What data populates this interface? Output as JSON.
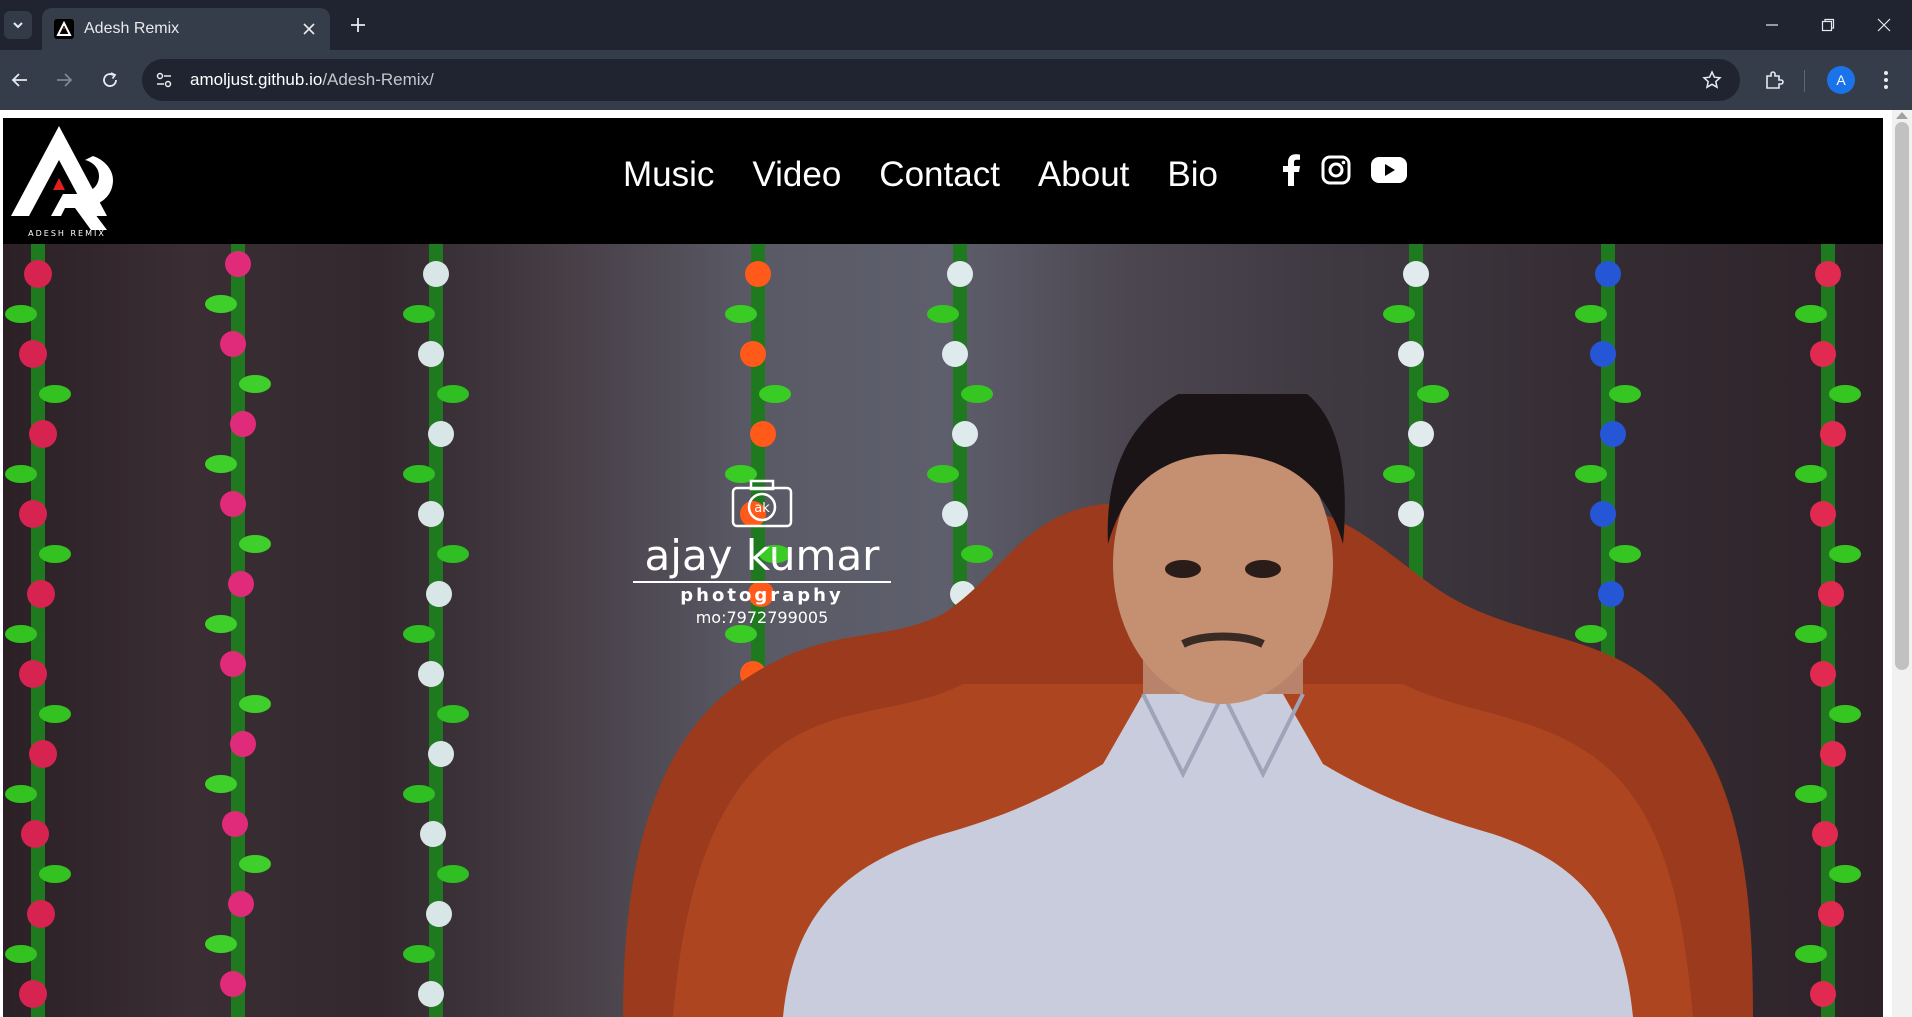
{
  "browser": {
    "tab": {
      "title": "Adesh Remix"
    },
    "url": {
      "host": "amoljust.github.io",
      "path": "/Adesh-Remix/"
    },
    "profile_initial": "A"
  },
  "site": {
    "logo_text": "ADESH REMIX",
    "nav": [
      {
        "label": "Music"
      },
      {
        "label": "Video"
      },
      {
        "label": "Contact"
      },
      {
        "label": "About"
      },
      {
        "label": "Bio"
      }
    ],
    "socials": [
      "facebook-icon",
      "instagram-icon",
      "youtube-icon"
    ]
  },
  "hero": {
    "watermark": {
      "badge": "ak",
      "name": "ajay kumar",
      "subtitle": "photography",
      "phone": "mo:7972799005"
    }
  },
  "colors": {
    "chrome_dark": "#1f2430",
    "chrome_toolbar": "#353c4a",
    "nav_bg": "#000000",
    "accent_red": "#e0201c",
    "avatar_blue": "#1a73e8"
  }
}
